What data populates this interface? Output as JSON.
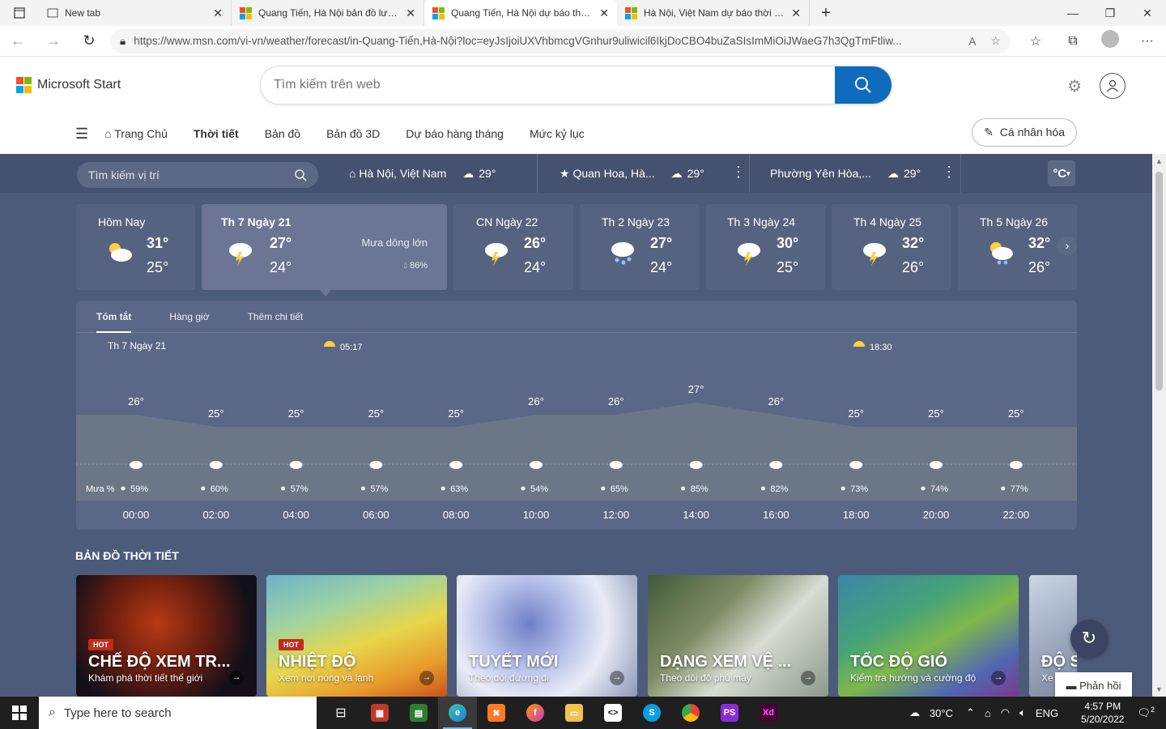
{
  "browser": {
    "tabs": [
      {
        "title": "New tab",
        "favicon": "newtab-icon"
      },
      {
        "title": "Quang Tiến, Hà Nội bản đồ lượng mưa",
        "favicon": "msn-logo"
      },
      {
        "title": "Quang Tiến, Hà Nội dự báo thời tiết",
        "favicon": "msn-logo",
        "active": true
      },
      {
        "title": "Hà Nội, Việt Nam dự báo thời tiết",
        "favicon": "msn-logo"
      }
    ],
    "url": "https://www.msn.com/vi-vn/weather/forecast/in-Quang-Tiến,Hà-Nội?loc=eyJsIjoiUXVhbmcgVGnhur9uliwicil6IkjDoCBO4buZaSIsImMiOiJWaeG7h3QgTmFtliw..."
  },
  "header": {
    "brand": "Microsoft Start",
    "search_placeholder": "Tìm kiếm trên web"
  },
  "nav": {
    "items": [
      "Trang Chủ",
      "Thời tiết",
      "Bản đồ",
      "Bản đồ 3D",
      "Dự báo hàng tháng",
      "Mức kỷ lục"
    ],
    "personalize": "Cá nhân hóa"
  },
  "locations": {
    "search_placeholder": "Tìm kiếm vị trí",
    "items": [
      {
        "name": "Hà Nội, Việt Nam",
        "temp": "29°"
      },
      {
        "name": "Quan Hoa, Hà...",
        "temp": "29°"
      },
      {
        "name": "Phường Yên Hòa,...",
        "temp": "29°"
      }
    ],
    "unit": "°C"
  },
  "days": [
    {
      "name": "Hôm Nay",
      "hi": "31°",
      "lo": "25°",
      "icon": "partly-cloudy-icon"
    },
    {
      "name": "Th 7 Ngày 21",
      "hi": "27°",
      "lo": "24°",
      "icon": "thunderstorm-icon",
      "cond": "Mưa dông lớn",
      "prob": "86%"
    },
    {
      "name": "CN Ngày 22",
      "hi": "26°",
      "lo": "24°",
      "icon": "thunderstorm-icon"
    },
    {
      "name": "Th 2 Ngày 23",
      "hi": "27°",
      "lo": "24°",
      "icon": "rain-icon"
    },
    {
      "name": "Th 3 Ngày 24",
      "hi": "30°",
      "lo": "25°",
      "icon": "thunderstorm-icon"
    },
    {
      "name": "Th 4 Ngày 25",
      "hi": "32°",
      "lo": "26°",
      "icon": "thunderstorm-icon"
    },
    {
      "name": "Th 5 Ngày 26",
      "hi": "32°",
      "lo": "26°",
      "icon": "partly-cloudy-rain-icon"
    }
  ],
  "panel": {
    "tabs": [
      "Tóm tắt",
      "Hàng giờ",
      "Thêm chi tiết"
    ],
    "day_label": "Th 7 Ngày 21",
    "sunrise": "05:17",
    "sunset": "18:30",
    "rain_label": "Mưa %"
  },
  "chart_data": {
    "type": "line",
    "hours": [
      "00:00",
      "02:00",
      "04:00",
      "06:00",
      "08:00",
      "10:00",
      "12:00",
      "14:00",
      "16:00",
      "18:00",
      "20:00",
      "22:00"
    ],
    "temps": [
      26,
      25,
      25,
      25,
      25,
      26,
      26,
      27,
      26,
      25,
      25,
      25
    ],
    "temp_labels": [
      "26°",
      "25°",
      "25°",
      "25°",
      "25°",
      "26°",
      "26°",
      "27°",
      "26°",
      "25°",
      "25°",
      "25°"
    ],
    "rain_probs": [
      "59%",
      "60%",
      "57%",
      "57%",
      "63%",
      "54%",
      "65%",
      "85%",
      "82%",
      "73%",
      "74%",
      "77%"
    ],
    "ylim": [
      24,
      28
    ]
  },
  "maps": {
    "title": "BẢN ĐỒ THỜI TIẾT",
    "cards": [
      {
        "title": "CHẾ ĐỘ XEM TR...",
        "sub": "Khám phá thời tiết thế giới",
        "hot": "HOT"
      },
      {
        "title": "NHIỆT ĐỘ",
        "sub": "Xem nơi nóng và lạnh",
        "hot": "HOT"
      },
      {
        "title": "TUYẾT MỚI",
        "sub": "Theo dõi đường đi",
        "hot": ""
      },
      {
        "title": "DẠNG XEM VỆ ...",
        "sub": "Theo dõi độ phủ mây",
        "hot": ""
      },
      {
        "title": "TỐC ĐỘ GIÓ",
        "sub": "Kiểm tra hướng và cường độ",
        "hot": ""
      },
      {
        "title": "ĐỘ S",
        "sub": "Xe",
        "hot": ""
      }
    ],
    "feedback": "Phản hồi"
  },
  "taskbar": {
    "search_placeholder": "Type here to search",
    "weather_temp": "30°C",
    "lang": "ENG",
    "time": "4:57 PM",
    "date": "5/20/2022",
    "notif_count": "2"
  }
}
